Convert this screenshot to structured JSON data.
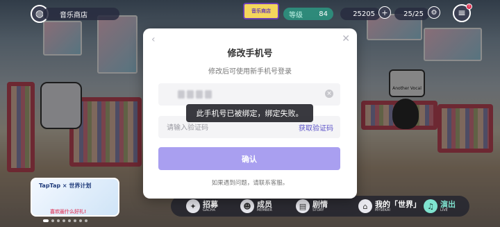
{
  "hud": {
    "location": "音乐商店",
    "level_label": "等级",
    "level_value": "84",
    "currency": "25205",
    "energy": "25/25",
    "logo_text": "音乐商店"
  },
  "ad": {
    "brand": "TapTap × 世界计划",
    "caption": "喜欢画什么好礼!"
  },
  "modal": {
    "title": "修改手机号",
    "subtitle": "修改后可使用新手机号登录",
    "code_placeholder": "请输入验证码",
    "get_code": "获取验证码",
    "confirm": "确认",
    "help": "如果遇到问题，请联系客服。"
  },
  "toast": "此手机号已被绑定，绑定失败。",
  "nav": [
    {
      "label": "招募",
      "sub": "GACHA"
    },
    {
      "label": "成员",
      "sub": "MEMBER"
    },
    {
      "label": "剧情",
      "sub": "STORY"
    },
    {
      "label": "我的「世界」",
      "sub": "MYSEKAI"
    },
    {
      "label": "演出",
      "sub": "LIVE"
    }
  ],
  "store_sign": "Another Vocal"
}
